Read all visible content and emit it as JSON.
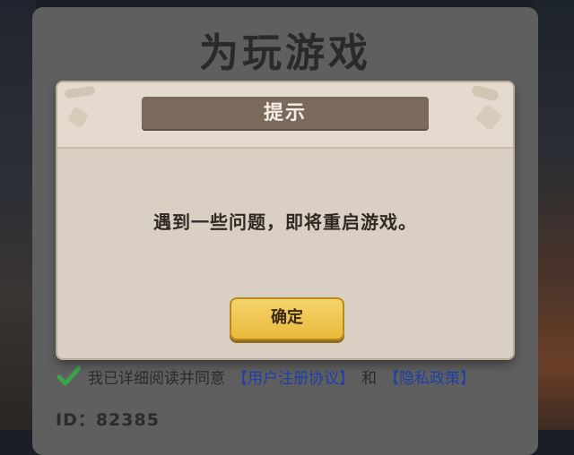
{
  "panel": {
    "title": "为玩游戏"
  },
  "dialog": {
    "title": "提示",
    "message": "遇到一些问题，即将重启游戏。",
    "ok_label": "确定"
  },
  "agreement": {
    "text": "我已详细阅读并同意",
    "user_agreement": "【用户注册协议】",
    "and": "和",
    "privacy_policy": "【隐私政策】",
    "checked": true
  },
  "id_label": "ID：82385",
  "colors": {
    "panel": "#5f5f5f",
    "dialog": "#d9cfc2",
    "title_bar": "#7a6a5c",
    "ok_button": "#efc54f",
    "link": "#1f3fa8",
    "check": "#3ca34a"
  }
}
